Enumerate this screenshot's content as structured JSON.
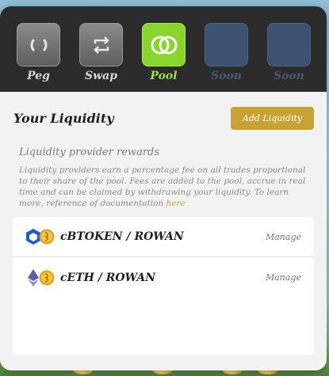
{
  "nav": {
    "items": [
      {
        "label": "Peg",
        "icon": "peg-icon",
        "state": "normal"
      },
      {
        "label": "Swap",
        "icon": "swap-icon",
        "state": "normal"
      },
      {
        "label": "Pool",
        "icon": "pool-icon",
        "state": "active"
      },
      {
        "label": "Soon",
        "icon": "placeholder-tile",
        "state": "disabled"
      },
      {
        "label": "Soon",
        "icon": "placeholder-tile",
        "state": "disabled"
      }
    ]
  },
  "header": {
    "title": "Your Liquidity",
    "add_button": "Add Liquidity"
  },
  "rewards": {
    "title": "Liquidity provider rewards",
    "text": "Liquidity providers earn a percentage fee on all trades proportional to their share of the pool. Fees are added to the pool, accrue in real time and can be claimed by withdrawing your liquidity. To learn more, reference of documentation",
    "link": "here"
  },
  "pools": [
    {
      "pair": "cBTOKEN / ROWAN",
      "action": "Manage",
      "token_icon": "cbtoken-icon",
      "base_icon": "rowan-icon"
    },
    {
      "pair": "cETH / ROWAN",
      "action": "Manage",
      "token_icon": "ethereum-icon",
      "base_icon": "rowan-icon"
    }
  ],
  "colors": {
    "accent": "#c8a233",
    "active_tab": "#88d62d",
    "nav_bg": "#2b2b2b",
    "panel_bg": "#f2f2f2"
  }
}
